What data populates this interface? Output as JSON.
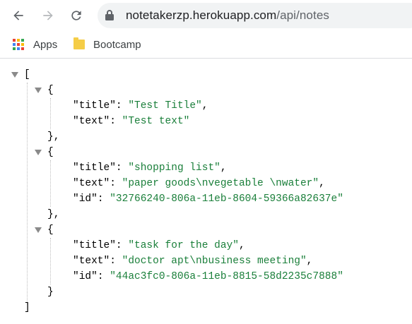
{
  "browser": {
    "url_host": "notetakerzp.herokuapp.com",
    "url_path": "/api/notes",
    "bookmarks": [
      {
        "label": "Apps",
        "icon": "apps-grid-icon"
      },
      {
        "label": "Bootcamp",
        "icon": "folder-icon"
      }
    ]
  },
  "json": {
    "open_bracket": "[",
    "close_bracket": "]",
    "notes": [
      {
        "title": "Test Title",
        "text": "Test text",
        "id": null
      },
      {
        "title": "shopping list",
        "text": "paper goods\\nvegetable \\nwater",
        "id": "32766240-806a-11eb-8604-59366a82637e"
      },
      {
        "title": "task for the day",
        "text": "doctor apt\\nbusiness meeting",
        "id": "44ac3fc0-806a-11eb-8815-58d2235c7888"
      }
    ]
  },
  "colors": {
    "string": "#1a7f3a",
    "toolbar_bg": "#ffffff",
    "omnibox_bg": "#f1f3f4",
    "triangle": "#8a8a8a"
  }
}
